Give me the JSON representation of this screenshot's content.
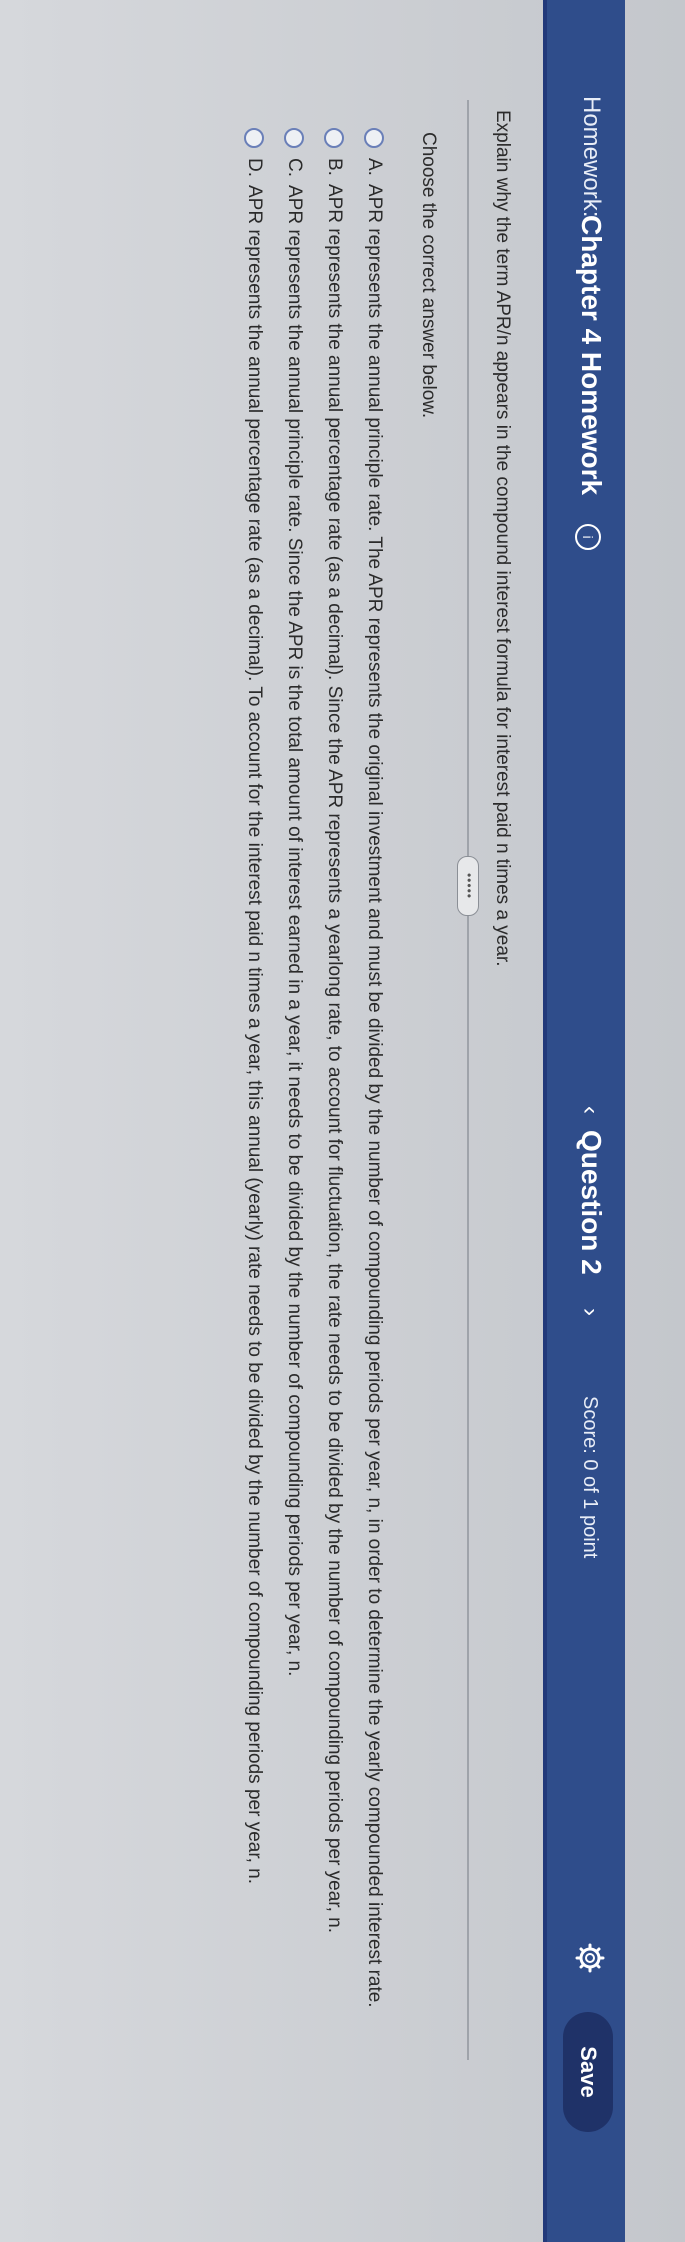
{
  "header": {
    "homework_label": "Homework:",
    "homework_title": "Chapter 4 Homework",
    "info_icon": "i",
    "prev": "‹",
    "question_label": "Question 2",
    "next": "›",
    "score": "Score: 0 of 1 point",
    "save": "Save"
  },
  "question": {
    "text": "Explain why the term APR/n appears in the compound interest formula for interest paid n times a year.",
    "more_button": "•••••",
    "instruction": "Choose the correct answer below."
  },
  "choices": [
    {
      "letter": "A.",
      "text": "APR represents the annual principle rate. The APR represents the original investment and must be divided by the number of compounding periods per year, n, in order to determine the yearly compounded interest rate."
    },
    {
      "letter": "B.",
      "text": "APR represents the annual percentage rate (as a decimal). Since the APR represents a yearlong rate, to account for fluctuation, the rate needs to be divided by the number of compounding periods per year, n."
    },
    {
      "letter": "C.",
      "text": "APR represents the annual principle rate. Since the APR is the total amount of interest earned in a year, it needs to be divided by the number of compounding periods per year, n."
    },
    {
      "letter": "D.",
      "text": "APR represents the annual percentage rate (as a decimal). To account for the interest paid n times a year, this annual (yearly) rate needs to be divided by the number of compounding periods per year, n."
    }
  ],
  "colors": {
    "header_bg": "#2f4d8b",
    "save_bg": "#1f3268",
    "page_bg": "#d6d8dc"
  }
}
